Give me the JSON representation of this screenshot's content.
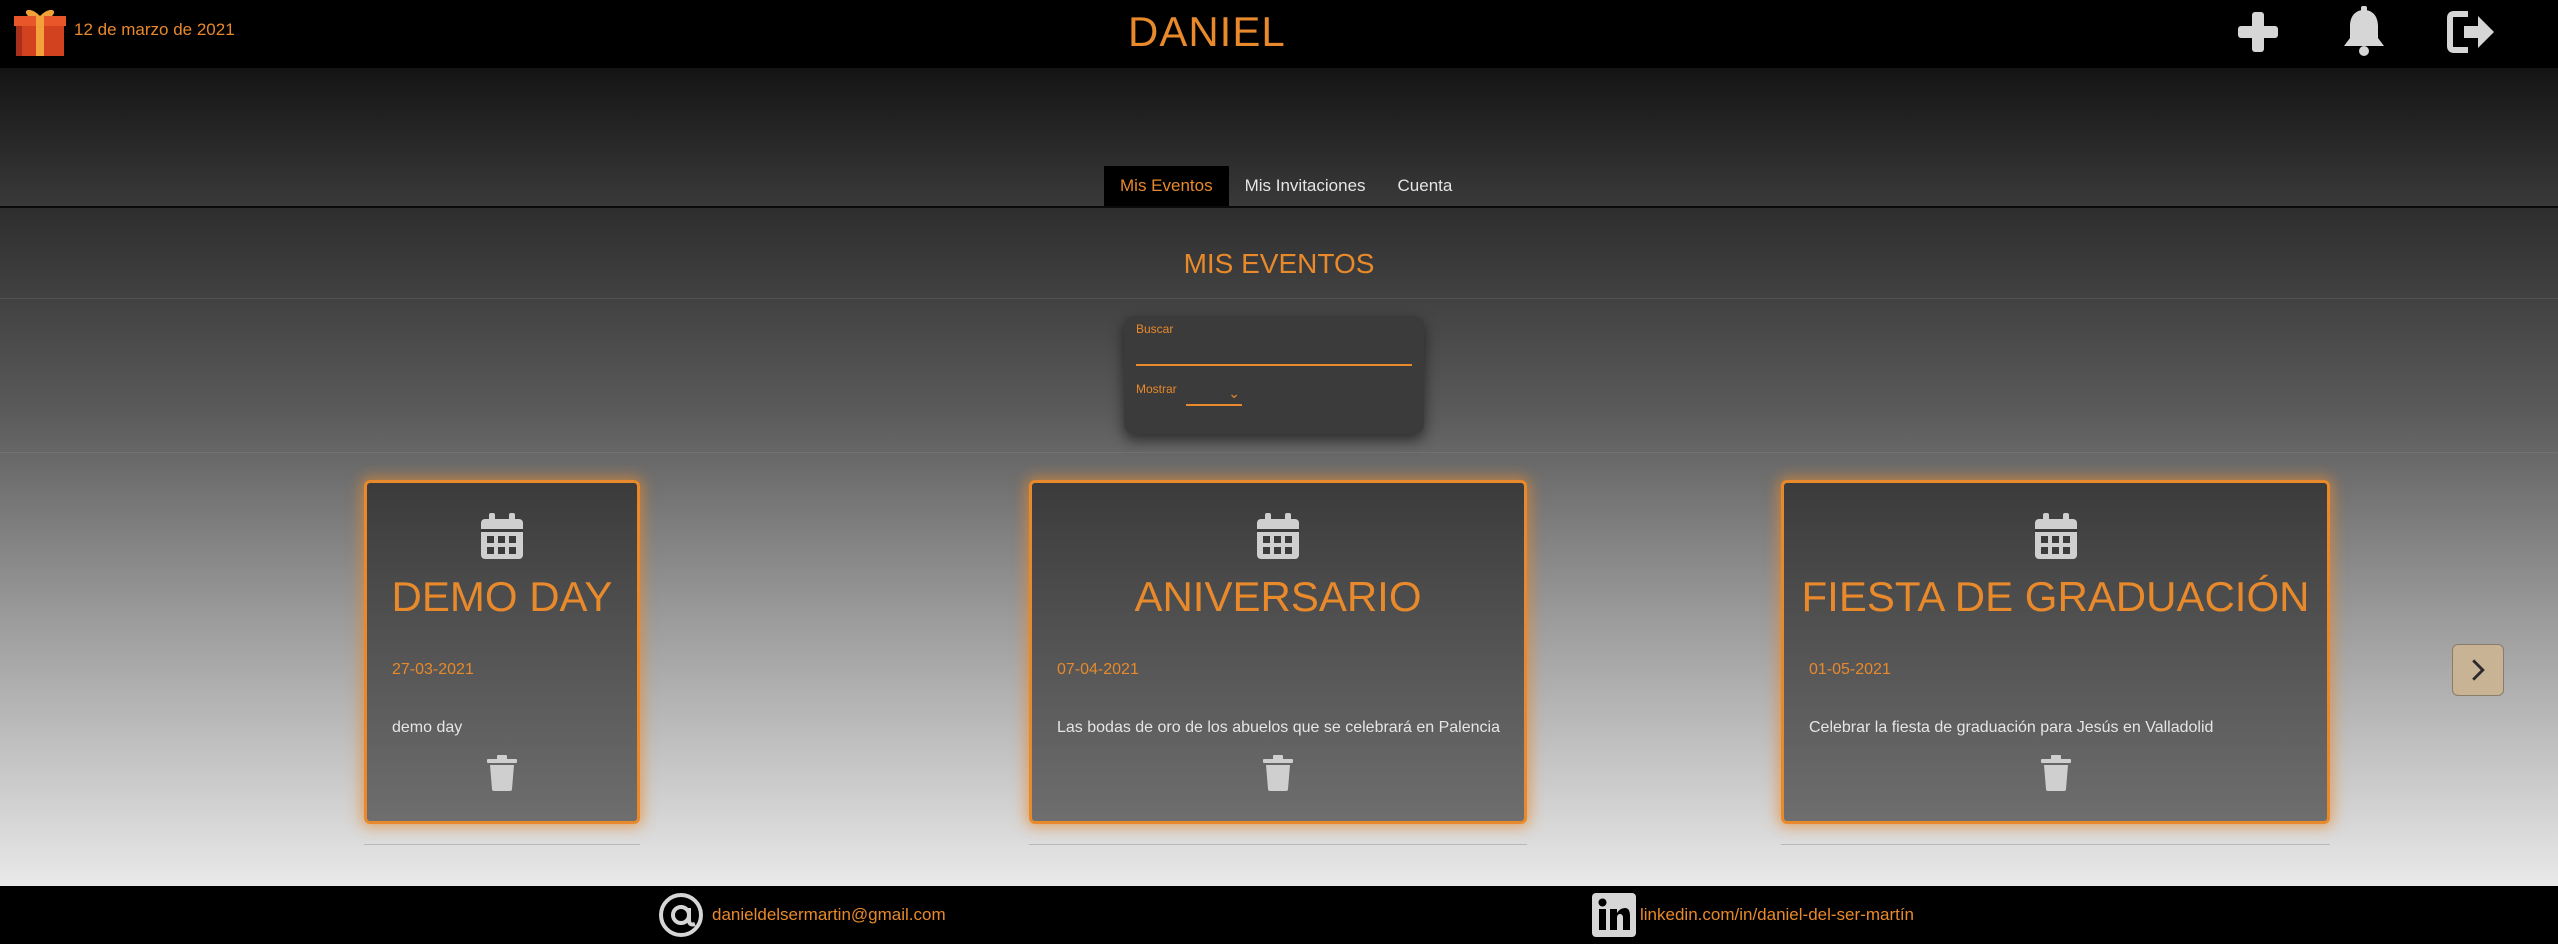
{
  "header": {
    "date": "12 de marzo de 2021",
    "user_name": "DANIEL",
    "icons": [
      "gift-icon",
      "plus-icon",
      "bell-icon",
      "logout-icon"
    ]
  },
  "tabs": [
    {
      "label": "Mis Eventos",
      "active": true
    },
    {
      "label": "Mis Invitaciones",
      "active": false
    },
    {
      "label": "Cuenta",
      "active": false
    }
  ],
  "main": {
    "title": "MIS EVENTOS",
    "filter": {
      "search_label": "Buscar",
      "search_value": "",
      "show_label": "Mostrar",
      "show_value": ""
    }
  },
  "events": [
    {
      "title": "DEMO DAY",
      "date": "27-03-2021",
      "description": "demo day"
    },
    {
      "title": "ANIVERSARIO",
      "date": "07-04-2021",
      "description": "Las bodas de oro de los abuelos que se celebrará en Palencia"
    },
    {
      "title": "FIESTA DE GRADUACIÓN",
      "date": "01-05-2021",
      "description": "Celebrar la fiesta de graduación para Jesús en Valladolid"
    }
  ],
  "footer": {
    "email": "danieldelsermartin@gmail.com",
    "linkedin": "linkedin.com/in/daniel-del-ser-martín"
  },
  "colors": {
    "accent": "#e8892b",
    "background": "#000000",
    "card": "#3b3b3b"
  }
}
